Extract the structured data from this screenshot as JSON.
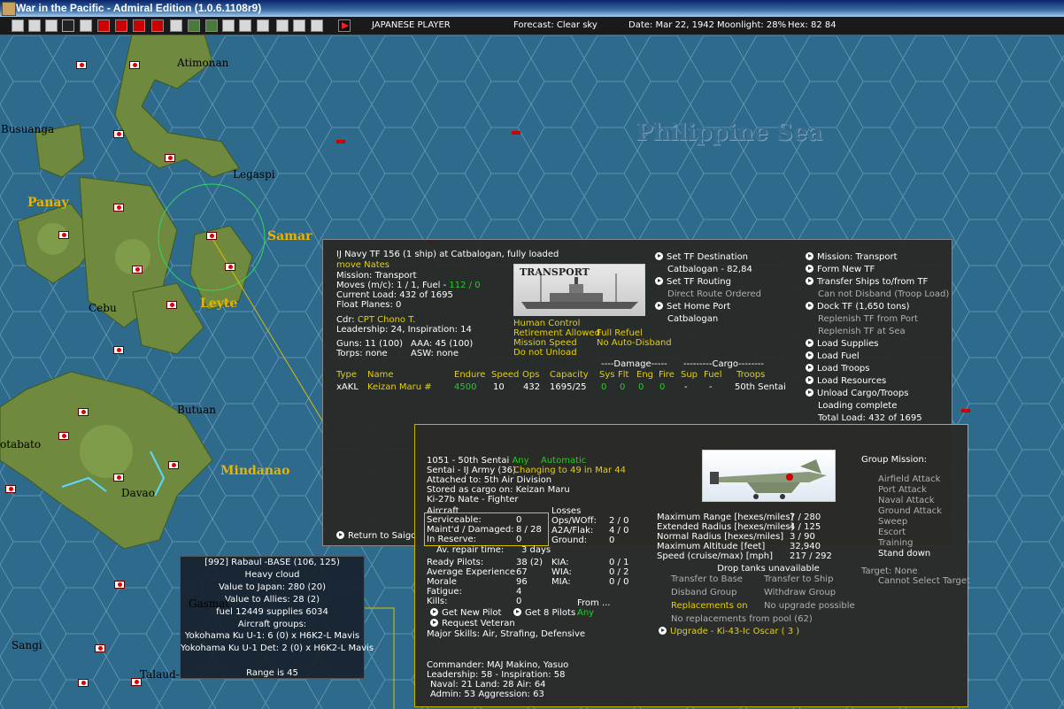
{
  "window": {
    "title": "War in the Pacific - Admiral Edition (1.0.6.1108r9)"
  },
  "toolbar": {
    "player": "JAPANESE PLAYER",
    "forecast": "Forecast: Clear sky",
    "date": "Date: Mar 22, 1942",
    "moonlight": "Moonlight: 28%",
    "hex": "Hex: 82  84"
  },
  "map": {
    "labels": {
      "atimonan": "Atimonan",
      "busuanga": "Busuanga",
      "legaspi": "Legaspi",
      "panay": "Panay",
      "samar": "Samar",
      "leyte": "Leyte",
      "cebu": "Cebu",
      "butuan": "Butuan",
      "otabato": "otabato",
      "mindanao": "Mindanao",
      "davao": "Davao",
      "sangi": "Sangi",
      "talaud": "Talaud-",
      "gasmat": "Gasmat"
    },
    "sea": "Philippine Sea"
  },
  "tf_panel": {
    "header": "IJ Navy TF 156 (1 ship) at Catbalogan, fully loaded",
    "move_link": "move Nates",
    "mission": "Mission: Transport",
    "moves_prefix": "Moves (m/c): 1 / 1, Fuel - ",
    "fuel": "112 / 0",
    "current_load": "Current Load: 432 of 1695",
    "float_planes": "Float Planes: 0",
    "cdr_prefix": "Cdr:",
    "cdr_name": "CPT  Chono T.",
    "leadership": "Leadership: 24, Inspiration: 14",
    "guns": "Guns: 11 (100)",
    "aaa": "AAA: 45 (100)",
    "torps": "Torps: none",
    "asw": "ASW: none",
    "photo_caption": "TRANSPORT",
    "options": {
      "human_control": "Human Control",
      "retirement": "Retirement Allowed",
      "full_refuel": "Full Refuel",
      "mission_speed": "Mission Speed",
      "no_auto_disband": "No Auto-Disband",
      "do_not_unload": "Do not Unload"
    },
    "actions_mid": [
      {
        "label": "Set TF Destination",
        "arrow": true,
        "style": "w"
      },
      {
        "label": "Catbalogan - 82,84",
        "arrow": false,
        "style": "w"
      },
      {
        "label": "Set TF Routing",
        "arrow": true,
        "style": "w"
      },
      {
        "label": "Direct Route Ordered",
        "arrow": false,
        "style": "d"
      },
      {
        "label": "Set Home Port",
        "arrow": true,
        "style": "w"
      },
      {
        "label": "Catbalogan",
        "arrow": false,
        "style": "w"
      }
    ],
    "actions_right": [
      {
        "label": "Mission: Transport",
        "arrow": true,
        "style": "w"
      },
      {
        "label": "Form New TF",
        "arrow": true,
        "style": "w"
      },
      {
        "label": "Transfer Ships to/from TF",
        "arrow": true,
        "style": "w"
      },
      {
        "label": "Can not Disband (Troop Load)",
        "arrow": false,
        "style": "d"
      },
      {
        "label": "Dock TF (1,650 tons)",
        "arrow": true,
        "style": "w"
      },
      {
        "label": "Replenish TF from Port",
        "arrow": false,
        "style": "d"
      },
      {
        "label": "Replenish TF at Sea",
        "arrow": false,
        "style": "d"
      },
      {
        "label": "Load Supplies",
        "arrow": true,
        "style": "w"
      },
      {
        "label": "Load Fuel",
        "arrow": true,
        "style": "w"
      },
      {
        "label": "Load Troops",
        "arrow": true,
        "style": "w"
      },
      {
        "label": "Load Resources",
        "arrow": true,
        "style": "w"
      },
      {
        "label": "Unload Cargo/Troops",
        "arrow": true,
        "style": "w"
      },
      {
        "label": "Loading complete",
        "arrow": false,
        "style": "w"
      },
      {
        "label": "Total Load: 432 of 1695",
        "arrow": false,
        "style": "w"
      }
    ],
    "table": {
      "group_damage": "----Damage-----",
      "group_cargo": "---------Cargo--------",
      "headers": [
        "Type",
        "Name",
        "Endure",
        "Speed",
        "Ops",
        "Capacity",
        "Sys",
        "Flt",
        "Eng",
        "Fire",
        "Sup",
        "Fuel",
        "Troops"
      ],
      "row": [
        "xAKL",
        "Keizan Maru #",
        "4500",
        "10",
        "432",
        "1695/25",
        "0",
        "0",
        "0",
        "0",
        "-",
        "-",
        "50th Sentai"
      ]
    },
    "return_to": "Return to Saigo"
  },
  "air_panel": {
    "unit": "1051 - 50th Sentai",
    "any": "Any",
    "automatic": "Automatic",
    "sentai": "Sentai - IJ Army (36)",
    "changing": "Changing to 49 in Mar 44",
    "attached": "Attached to: 5th Air Division",
    "stored": "Stored as cargo on: Keizan Maru",
    "aircraft_type": "Ki-27b Nate - Fighter",
    "aircraft_hdr": "Aircraft",
    "serviceable_lbl": "Serviceable:",
    "serviceable": "0",
    "maintd_lbl": "Maint'd / Damaged:",
    "maintd": "8 / 28",
    "reserve_lbl": "In Reserve:",
    "reserve": "0",
    "losses_hdr": "Losses",
    "opsw_lbl": "Ops/WOff:",
    "opsw": "2 / 0",
    "a2a_lbl": "A2A/Flak:",
    "a2a": "4 / 0",
    "ground_lbl": "Ground:",
    "ground": "0",
    "repair_lbl": "Av. repair time:",
    "repair": "3 days",
    "ready_lbl": "Ready Pilots:",
    "ready": "38 (2)",
    "avgexp_lbl": "Average Experience",
    "avgexp": "67",
    "morale_lbl": "Morale",
    "morale": "96",
    "fatigue_lbl": "Fatigue:",
    "fatigue": "4",
    "kills_lbl": "Kills:",
    "kills": "0",
    "kia_lbl": "KIA:",
    "kia": "0 / 1",
    "wia_lbl": "WIA:",
    "wia": "0 / 2",
    "mia_lbl": "MIA:",
    "mia": "0 / 0",
    "from_lbl": "From ...",
    "from_any": "Any",
    "get_new_pilot": "Get New Pilot",
    "get_8_pilots": "Get 8 Pilots",
    "request_veteran": "Request Veteran",
    "major_skills": "Major Skills: Air, Strafing, Defensive",
    "commander": "Commander: MAJ Makino, Yasuo",
    "cmd_leadership": "Leadership: 58 - Inspiration: 58",
    "cmd_naval": "Naval: 21  Land: 28  Air: 64",
    "cmd_admin": "Admin: 53  Aggression: 63",
    "stats": [
      {
        "label": "Maximum Range [hexes/miles]",
        "value": "7 / 280"
      },
      {
        "label": "Extended Radius [hexes/miles]",
        "value": "4 / 125"
      },
      {
        "label": "Normal Radius [hexes/miles]",
        "value": "3 / 90"
      },
      {
        "label": "Maximum Altitude [feet]",
        "value": "32,940"
      },
      {
        "label": "Speed (cruise/max) [mph]",
        "value": "217 / 292"
      }
    ],
    "drop_tanks": "Drop tanks unavailable",
    "transfer_base": "Transfer to Base",
    "transfer_ship": "Transfer to Ship",
    "disband": "Disband Group",
    "withdraw": "Withdraw Group",
    "replacements": "Replacements on",
    "no_upgrade": "No upgrade possible",
    "no_replacements": "No replacements from pool (62)",
    "upgrade": "Upgrade - Ki-43-Ic Oscar  ( 3 )",
    "group_mission_hdr": "Group Mission:",
    "missions": [
      {
        "label": "Airfield Attack",
        "style": "d"
      },
      {
        "label": "Port Attack",
        "style": "d"
      },
      {
        "label": "Naval Attack",
        "style": "d"
      },
      {
        "label": "Ground Attack",
        "style": "d"
      },
      {
        "label": "Sweep",
        "style": "d"
      },
      {
        "label": "Escort",
        "style": "d"
      },
      {
        "label": "Training",
        "style": "d"
      },
      {
        "label": "Stand down",
        "style": "w"
      }
    ],
    "target": "Target: None",
    "cannot_select": "Cannot Select Target"
  },
  "base_panel": {
    "title": "[992] Rabaul  -BASE (106, 125)",
    "weather": "Heavy cloud",
    "value_japan": "Value to Japan: 280 (20)",
    "value_allies": "Value to Allies: 28 (2)",
    "supplies": "fuel 12449  supplies 6034",
    "groups_hdr": "Aircraft groups:",
    "group1": "Yokohama Ku U-1: 6 (0) x H6K2-L Mavis",
    "group2": "Yokohama Ku U-1 Det: 2 (0) x H6K2-L Mavis",
    "range": "Range is 45"
  },
  "colors": {
    "title_bar": "#0a246a",
    "accent_yellow": "#e8d000",
    "accent_green": "#20d020",
    "sea": "#2e6a8c",
    "land": "#6f8a3e"
  }
}
